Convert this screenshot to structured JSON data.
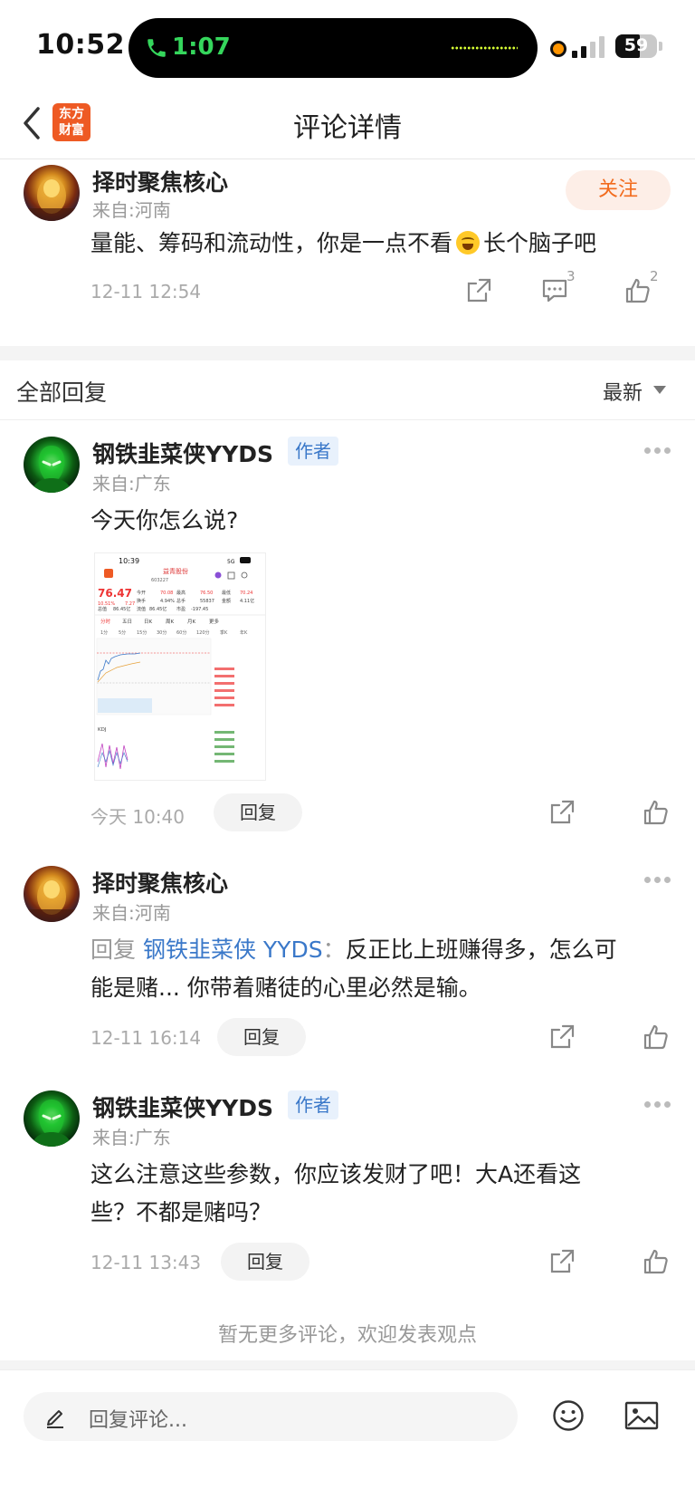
{
  "status_bar": {
    "time": "10:52",
    "call_time": "1:07",
    "battery": "59"
  },
  "nav": {
    "logo_line1": "东方",
    "logo_line2": "财富",
    "title": "评论详情"
  },
  "post": {
    "author": "择时聚焦核心",
    "location": "来自:河南",
    "follow_label": "关注",
    "text_before": "量能、筹码和流动性，你是一点不看",
    "text_after": "长个脑子吧",
    "time": "12-11 12:54",
    "comment_count": "3",
    "like_count": "2"
  },
  "replies_header": {
    "label": "全部回复",
    "sort": "最新"
  },
  "replies": [
    {
      "author": "钢铁韭菜侠YYDS",
      "tag": "作者",
      "location": "来自:广东",
      "text": "今天你怎么说?",
      "time": "今天 10:40",
      "reply_label": "回复"
    },
    {
      "author": "择时聚焦核心",
      "location": "来自:河南",
      "prefix": "回复",
      "mention": "钢铁韭菜侠 YYDS",
      "separator": "：",
      "text_line1": "反正比上班赚得多，怎么可",
      "text_line2": "能是赌... 你带着赌徒的心里必然是输。",
      "time": "12-11 16:14",
      "reply_label": "回复"
    },
    {
      "author": "钢铁韭菜侠YYDS",
      "tag": "作者",
      "location": "来自:广东",
      "text_line1": "这么注意这些参数，你应该发财了吧！大A还看这",
      "text_line2": "些？不都是赌吗？",
      "time": "12-11 13:43",
      "reply_label": "回复"
    }
  ],
  "end_note": "暂无更多评论，欢迎发表观点",
  "composer": {
    "placeholder": "回复评论..."
  },
  "thumb": {
    "time": "10:39",
    "net": "5G",
    "stock_name": "益青股份",
    "code": "603227",
    "price": "76.47",
    "change": "10.51%",
    "change_abs": "7.27",
    "tabs": [
      "分时",
      "五日",
      "日K",
      "周K",
      "月K",
      "更多"
    ],
    "periods": [
      "1分",
      "5分",
      "15分",
      "30分",
      "60分",
      "120分",
      "季K",
      "年K"
    ],
    "row1": [
      "今开",
      "70.08",
      "最高",
      "76.50",
      "最低",
      "70.24"
    ],
    "row2": [
      "换手",
      "4.94%",
      "总手",
      "55837",
      "金额",
      "4.11亿"
    ],
    "row3": [
      "总值",
      "86.45亿",
      "流值",
      "86.45亿",
      "市盈",
      "-197.45"
    ],
    "kdj": "KDJ"
  }
}
